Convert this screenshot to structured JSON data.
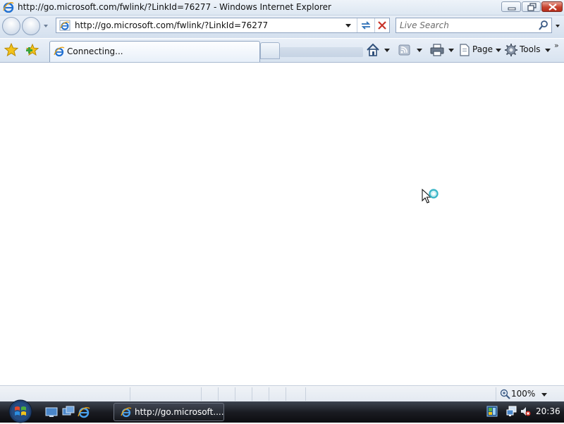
{
  "window": {
    "title": "http://go.microsoft.com/fwlink/?LinkId=76277 - Windows Internet Explorer"
  },
  "navbar": {
    "address_url": "http://go.microsoft.com/fwlink/?LinkId=76277",
    "search_placeholder": "Live Search"
  },
  "tabs": [
    {
      "label": "Connecting...",
      "active": true
    }
  ],
  "command_bar": {
    "page_label": "Page",
    "tools_label": "Tools",
    "overflow": "»"
  },
  "status_bar": {
    "zoom": "100%"
  },
  "taskbar": {
    "window_button_label": "http://go.microsoft....",
    "clock": "20:36"
  },
  "colors": {
    "chrome_top": "#eef3f9",
    "chrome_bottom": "#d4e0ee",
    "close_red": "#c7442f",
    "taskbar": "#1a1c22",
    "ie_blue": "#1f6fd1"
  }
}
